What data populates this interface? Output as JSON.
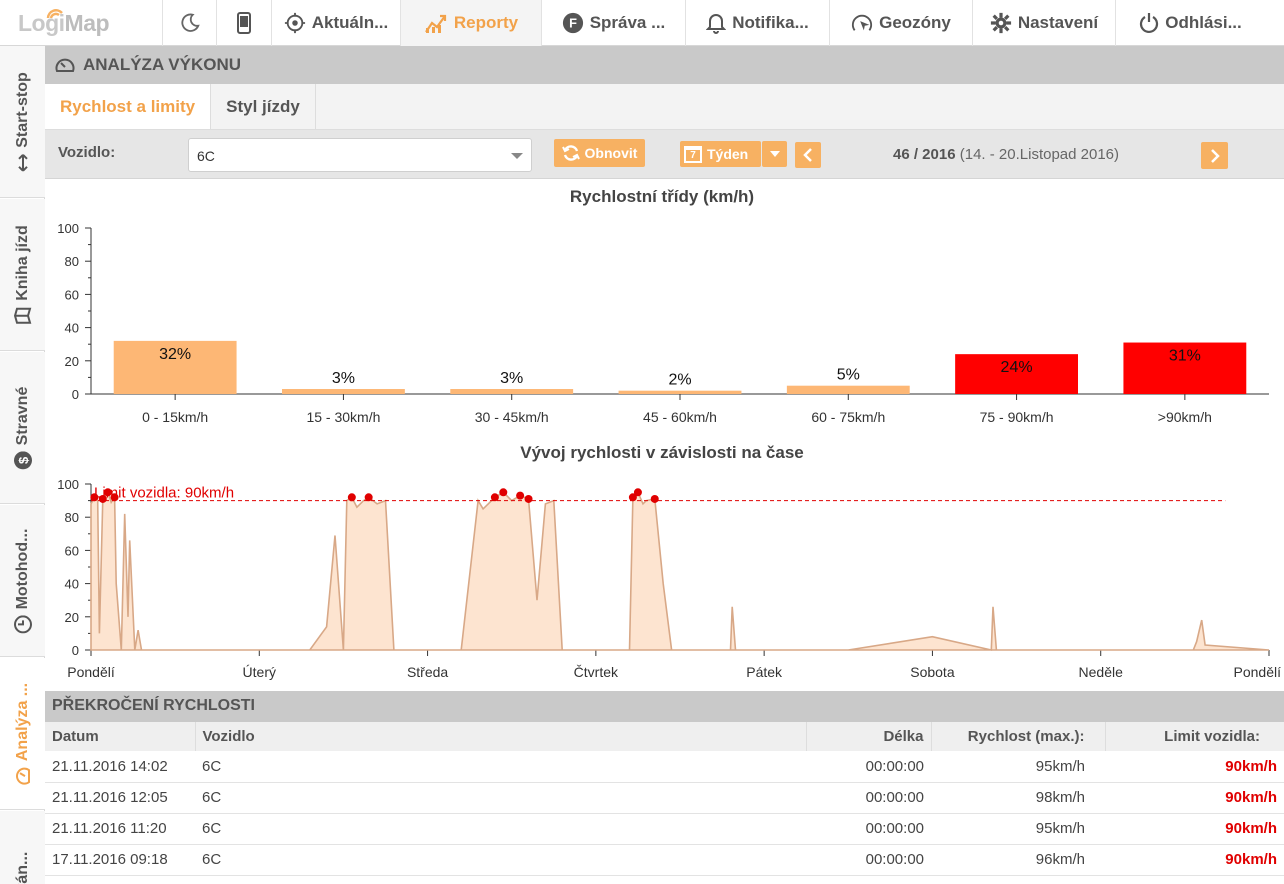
{
  "nav": {
    "logo": {
      "part1": "Logi",
      "part2": "Map"
    },
    "items": [
      {
        "label": "",
        "icon": "moon-icon"
      },
      {
        "label": "",
        "icon": "mobile-icon"
      },
      {
        "label": "Aktuáln...",
        "icon": "target-icon"
      },
      {
        "label": "Reporty",
        "icon": "chart-icon",
        "active": true
      },
      {
        "label": "Správa ...",
        "icon": "f-circle-icon"
      },
      {
        "label": "Notifika...",
        "icon": "bell-icon"
      },
      {
        "label": "Geozóny",
        "icon": "geofence-icon"
      },
      {
        "label": "Nastavení",
        "icon": "gear-icon"
      },
      {
        "label": "Odhlási...",
        "icon": "power-icon"
      }
    ]
  },
  "sidebar": {
    "items": [
      {
        "label": "Start-stop",
        "icon": "arrows-icon"
      },
      {
        "label": "Kniha jízd",
        "icon": "book-icon"
      },
      {
        "label": "Stravné",
        "icon": "dollar-icon"
      },
      {
        "label": "Motohod...",
        "icon": "clock-icon"
      },
      {
        "label": "Analýza ...",
        "icon": "gauge-icon",
        "active": true
      },
      {
        "label": "ován...",
        "icon": ""
      }
    ]
  },
  "section": {
    "title": "ANALÝZA VÝKONU"
  },
  "tabs": [
    {
      "label": "Rychlost a limity",
      "active": true
    },
    {
      "label": "Styl jízdy"
    }
  ],
  "filter": {
    "vehicle_label": "Vozidlo:",
    "vehicle_value": "6C",
    "refresh_label": "Obnovit",
    "period_label": "Týden",
    "period_icon_text": "7",
    "week": "46 / 2016",
    "week_range": "(14. - 20.Listopad 2016)"
  },
  "colors": {
    "accent": "#f2a24a",
    "bar_normal": "#fdb775",
    "bar_over": "#ff0000",
    "limit_line": "#e00000"
  },
  "chart_data": [
    {
      "type": "bar",
      "title": "Rychlostní třídy (km/h)",
      "categories": [
        "0 - 15km/h",
        "15 - 30km/h",
        "30 - 45km/h",
        "45 - 60km/h",
        "60 - 75km/h",
        "75 - 90km/h",
        ">90km/h"
      ],
      "values": [
        32,
        3,
        3,
        2,
        5,
        24,
        31
      ],
      "labels": [
        "32%",
        "3%",
        "3%",
        "2%",
        "5%",
        "24%",
        "31%"
      ],
      "over_limit": [
        false,
        false,
        false,
        false,
        false,
        true,
        true
      ],
      "ylim": [
        0,
        100
      ],
      "yticks": [
        0,
        20,
        40,
        60,
        80,
        100
      ]
    },
    {
      "type": "area",
      "title": "Vývoj rychlosti v závislosti na čase",
      "x_ticks": [
        "Pondělí",
        "Úterý",
        "Středa",
        "Čtvrtek",
        "Pátek",
        "Sobota",
        "Neděle",
        "Pondělí"
      ],
      "ylim": [
        0,
        100
      ],
      "yticks": [
        0,
        20,
        40,
        60,
        80,
        100
      ],
      "limit": 90,
      "limit_label": "Limit vozidla: 90km/h",
      "x": [
        0.0,
        0.02,
        0.04,
        0.05,
        0.07,
        0.1,
        0.12,
        0.14,
        0.15,
        0.18,
        0.2,
        0.22,
        0.23,
        0.26,
        0.28,
        0.3,
        0.32,
        0.34,
        0.36,
        0.38,
        0.4,
        0.42,
        0.45,
        0.5,
        0.52,
        0.55,
        0.6,
        0.8,
        1.0,
        1.3,
        1.4,
        1.45,
        1.5,
        1.52,
        1.55,
        1.58,
        1.62,
        1.65,
        1.7,
        1.75,
        1.8,
        1.9,
        2.2,
        2.3,
        2.33,
        2.36,
        2.4,
        2.45,
        2.5,
        2.55,
        2.6,
        2.65,
        2.7,
        2.75,
        2.8,
        3.0,
        3.2,
        3.22,
        3.25,
        3.28,
        3.3,
        3.35,
        3.4,
        3.45,
        3.5,
        3.6,
        3.8,
        3.81,
        3.83,
        4.0,
        4.5,
        5.0,
        5.35,
        5.36,
        5.38,
        6.0,
        6.5,
        6.55,
        6.57,
        6.6,
        6.62,
        7.0
      ],
      "values": [
        88,
        92,
        90,
        10,
        91,
        95,
        89,
        92,
        40,
        0,
        82,
        20,
        66,
        0,
        12,
        0,
        0,
        0,
        0,
        0,
        0,
        0,
        0,
        0,
        0,
        0,
        0,
        0,
        0,
        0,
        14,
        69,
        0,
        90,
        92,
        86,
        90,
        92,
        88,
        90,
        0,
        0,
        0,
        90,
        85,
        88,
        92,
        95,
        90,
        93,
        91,
        30,
        88,
        90,
        0,
        0,
        0,
        92,
        95,
        88,
        90,
        91,
        40,
        0,
        0,
        0,
        0,
        26,
        0,
        0,
        0,
        8,
        0,
        26,
        0,
        0,
        0,
        0,
        5,
        18,
        3,
        0
      ]
    }
  ],
  "overspeed": {
    "title": "PŘEKROČENÍ RYCHLOSTI",
    "columns": [
      "Datum",
      "Vozidlo",
      "Délka",
      "Rychlost (max.):",
      "Limit vozidla:"
    ],
    "rows": [
      [
        "21.11.2016 14:02",
        "6C",
        "00:00:00",
        "95km/h",
        "90km/h"
      ],
      [
        "21.11.2016 12:05",
        "6C",
        "00:00:00",
        "98km/h",
        "90km/h"
      ],
      [
        "21.11.2016 11:20",
        "6C",
        "00:00:00",
        "95km/h",
        "90km/h"
      ],
      [
        "17.11.2016 09:18",
        "6C",
        "00:00:00",
        "96km/h",
        "90km/h"
      ]
    ]
  }
}
